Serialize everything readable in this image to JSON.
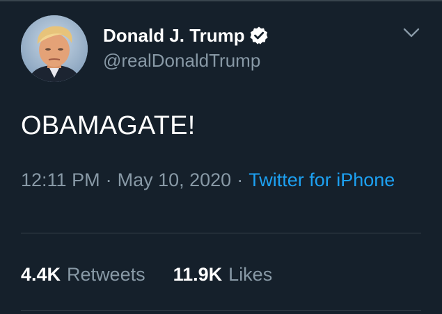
{
  "author": {
    "display_name": "Donald J. Trump",
    "handle": "@realDonaldTrump",
    "verified_icon": "verified-badge-icon",
    "avatar_icon": "profile-photo"
  },
  "menu": {
    "icon": "chevron-down-icon"
  },
  "tweet": {
    "text": "OBAMAGATE!",
    "time": "12:11 PM",
    "separator": "·",
    "date": "May 10, 2020",
    "source": "Twitter for iPhone"
  },
  "stats": {
    "retweets_count": "4.4K",
    "retweets_label": "Retweets",
    "likes_count": "11.9K",
    "likes_label": "Likes"
  },
  "colors": {
    "background": "#15202b",
    "primary_text": "#ffffff",
    "secondary_text": "#8899a6",
    "link": "#1da1f2",
    "divider": "#38444d"
  }
}
